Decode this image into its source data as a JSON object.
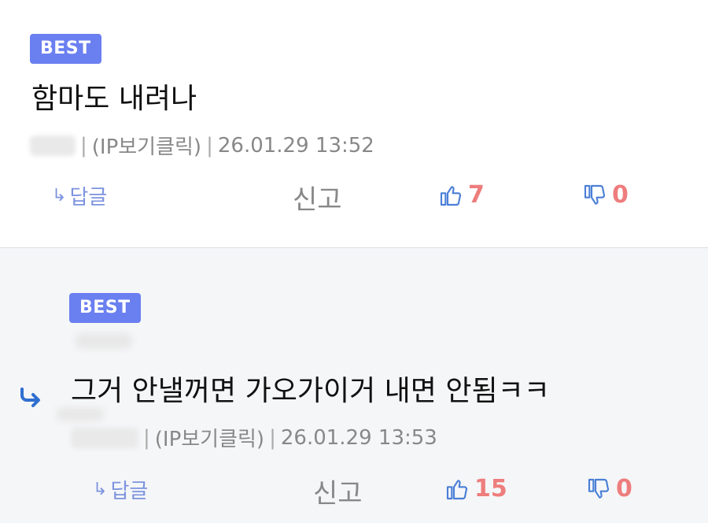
{
  "comments": [
    {
      "badge": "BEST",
      "text": "함마도 내려나",
      "ip_label": "(IP보기클릭)",
      "date": "26.01.29 13:52",
      "reply_label": "답글",
      "report_label": "신고",
      "likes": "7",
      "dislikes": "0"
    },
    {
      "badge": "BEST",
      "text": "그거 안낼꺼면 가오가이거 내면 안됨ㅋㅋ",
      "ip_label": "(IP보기클릭)",
      "date": "26.01.29 13:53",
      "reply_label": "답글",
      "report_label": "신고",
      "likes": "15",
      "dislikes": "0"
    }
  ],
  "icons": {
    "reply_arrow": "reply-arrow-icon",
    "thumbs_up": "thumbs-up-icon",
    "thumbs_down": "thumbs-down-icon",
    "reply_indicator": "reply-indicator-icon"
  },
  "colors": {
    "badge": "#6a7ff0",
    "vote_count": "#ee7d7d",
    "reply_link": "#7c93df",
    "icon_blue": "#4a7fd6"
  }
}
